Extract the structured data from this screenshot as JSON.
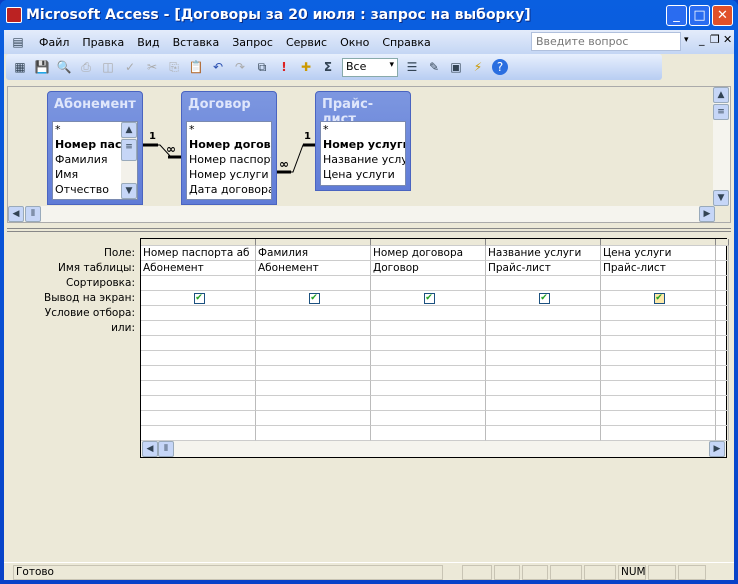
{
  "window": {
    "title": "Microsoft Access - [Договоры за 20 июля : запрос на выборку]"
  },
  "menu": {
    "items": [
      "Файл",
      "Правка",
      "Вид",
      "Вставка",
      "Запрос",
      "Сервис",
      "Окно",
      "Справка"
    ],
    "ask_placeholder": "Введите вопрос"
  },
  "toolbar": {
    "top_values": "Все",
    "icons": [
      "view-icon",
      "save-icon",
      "print-preview-icon",
      "print-icon",
      "preview-icon",
      "spelling-icon",
      "cut-icon",
      "copy-icon",
      "paste-icon",
      "undo-icon",
      "redo-icon",
      "query-type-icon",
      "run-icon",
      "show-table-icon",
      "totals-icon",
      "properties-icon",
      "build-icon",
      "database-window-icon",
      "new-object-icon",
      "help-icon"
    ]
  },
  "tables": [
    {
      "name": "Абонемент",
      "fields": [
        "*",
        "Номер паспорта",
        "Фамилия",
        "Имя",
        "Отчество"
      ]
    },
    {
      "name": "Договор",
      "fields": [
        "*",
        "Номер договора",
        "Номер паспорта",
        "Номер услуги",
        "Дата договора"
      ]
    },
    {
      "name": "Прайс-лист",
      "fields": [
        "*",
        "Номер услуги",
        "Название услуги",
        "Цена услуги"
      ]
    }
  ],
  "relations": [
    {
      "one": "1",
      "many": "∞"
    },
    {
      "one": "1",
      "many": "∞"
    }
  ],
  "grid": {
    "row_labels": [
      "Поле:",
      "Имя таблицы:",
      "Сортировка:",
      "Вывод на экран:",
      "Условие отбора:",
      "или:"
    ],
    "columns": [
      {
        "field": "Номер паспорта аб",
        "table": "Абонемент",
        "show": true
      },
      {
        "field": "Фамилия",
        "table": "Абонемент",
        "show": true
      },
      {
        "field": "Номер договора",
        "table": "Договор",
        "show": true
      },
      {
        "field": "Название услуги",
        "table": "Прайс-лист",
        "show": true
      },
      {
        "field": "Цена услуги",
        "table": "Прайс-лист",
        "show": true
      }
    ]
  },
  "status": {
    "text": "Готово",
    "num": "NUM"
  }
}
